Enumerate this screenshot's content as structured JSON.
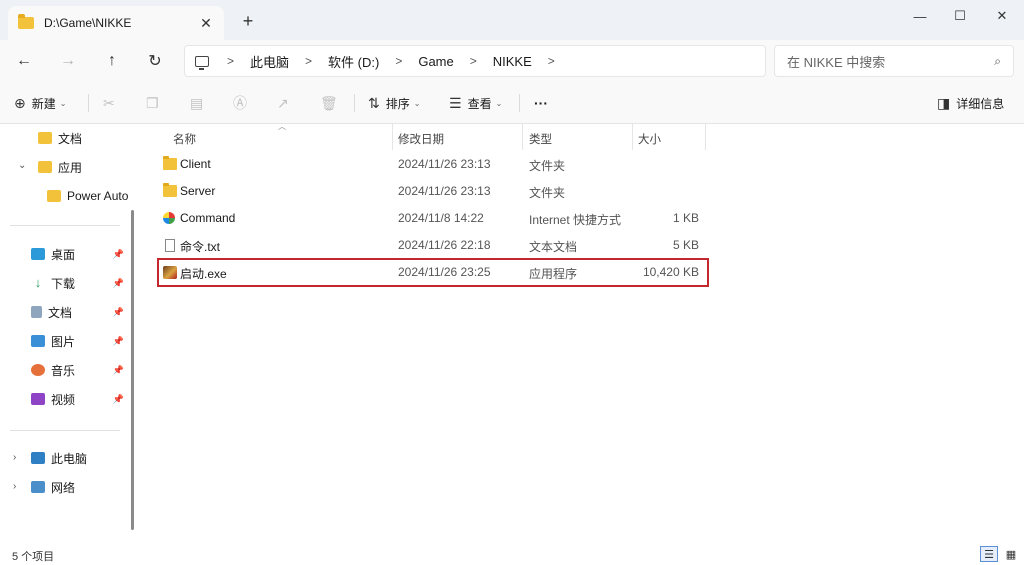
{
  "tab": {
    "title": "D:\\Game\\NIKKE",
    "close": "✕",
    "new": "+"
  },
  "window": {
    "minimize": "—",
    "maximize": "☐",
    "close": "✕"
  },
  "nav": {
    "back": "←",
    "forward": "→",
    "up": "↑",
    "refresh": "↻"
  },
  "breadcrumb": [
    {
      "label": "此电脑"
    },
    {
      "label": "软件 (D:)"
    },
    {
      "label": "Game"
    },
    {
      "label": "NIKKE"
    }
  ],
  "breadcrumb_sep": ">",
  "search": {
    "placeholder": "在 NIKKE 中搜索",
    "icon": "🔍"
  },
  "toolbar": {
    "new_label": "新建",
    "sort_label": "排序",
    "view_label": "查看",
    "more_label": "···",
    "details_label": "详细信息"
  },
  "sidebar": {
    "items": [
      {
        "label": "文档",
        "icon": "folder-icon"
      },
      {
        "label": "应用",
        "icon": "folder-icon"
      },
      {
        "label": "Power Auto",
        "icon": "folder-icon"
      },
      {
        "label": "桌面",
        "icon": "desktop-icon"
      },
      {
        "label": "下载",
        "icon": "download-icon"
      },
      {
        "label": "文档",
        "icon": "document-icon"
      },
      {
        "label": "图片",
        "icon": "pictures-icon"
      },
      {
        "label": "音乐",
        "icon": "music-icon"
      },
      {
        "label": "视频",
        "icon": "video-icon"
      },
      {
        "label": "此电脑",
        "icon": "computer-icon"
      },
      {
        "label": "网络",
        "icon": "network-icon"
      }
    ]
  },
  "columns": {
    "name": "名称",
    "modified": "修改日期",
    "type": "类型",
    "size": "大小"
  },
  "files": [
    {
      "name": "Client",
      "modified": "2024/11/26 23:13",
      "type": "文件夹",
      "size": "",
      "icon": "folder-icon"
    },
    {
      "name": "Server",
      "modified": "2024/11/26 23:13",
      "type": "文件夹",
      "size": "",
      "icon": "folder-icon"
    },
    {
      "name": "Command",
      "modified": "2024/11/8 14:22",
      "type": "Internet 快捷方式",
      "size": "1 KB",
      "icon": "internet-shortcut-icon"
    },
    {
      "name": "命令.txt",
      "modified": "2024/11/26 22:18",
      "type": "文本文档",
      "size": "5 KB",
      "icon": "text-file-icon"
    },
    {
      "name": "启动.exe",
      "modified": "2024/11/26 23:25",
      "type": "应用程序",
      "size": "10,420 KB",
      "icon": "exe-icon"
    }
  ],
  "status": {
    "count": "5 个项目"
  },
  "colors": {
    "highlight": "#c1272d",
    "folder": "#f3c23b",
    "titlebar": "#eef1f6"
  }
}
